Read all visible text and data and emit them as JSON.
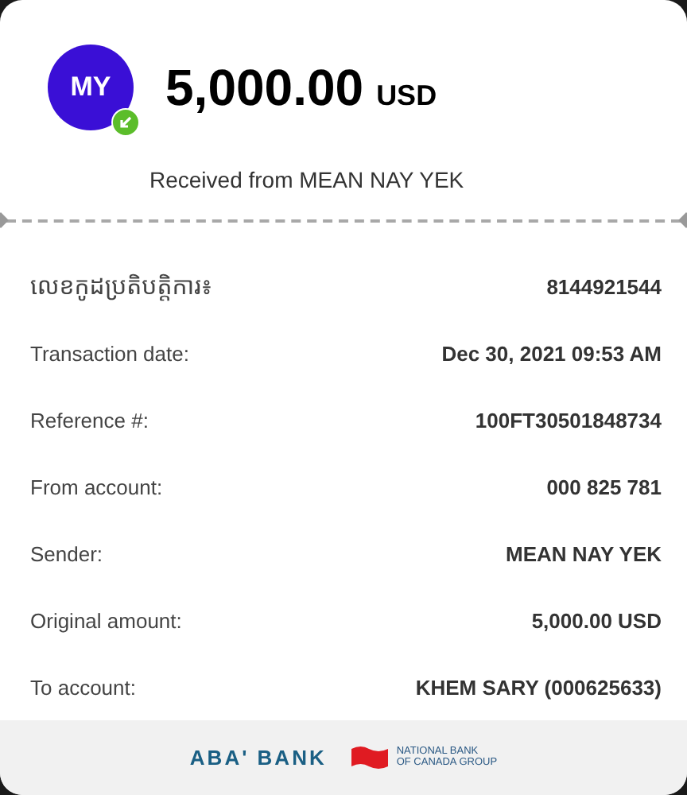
{
  "header": {
    "avatar_initials": "MY",
    "received": true,
    "amount": "5,000.00",
    "currency": "USD",
    "subtitle": "Received from MEAN NAY YEK"
  },
  "details": [
    {
      "label": "លេខកូដប្រតិបត្តិការ៖",
      "value": "8144921544"
    },
    {
      "label": "Transaction date:",
      "value": "Dec 30, 2021 09:53 AM"
    },
    {
      "label": "Reference #:",
      "value": "100FT30501848734"
    },
    {
      "label": "From account:",
      "value": "000 825 781"
    },
    {
      "label": "Sender:",
      "value": "MEAN NAY YEK"
    },
    {
      "label": "Original amount:",
      "value": "5,000.00 USD"
    },
    {
      "label": "To account:",
      "value": "KHEM SARY (000625633)"
    }
  ],
  "footer": {
    "bank_logo": "ABA' BANK",
    "partner_logo_lines": [
      "NATIONAL BANK",
      "OF CANADA GROUP"
    ]
  }
}
